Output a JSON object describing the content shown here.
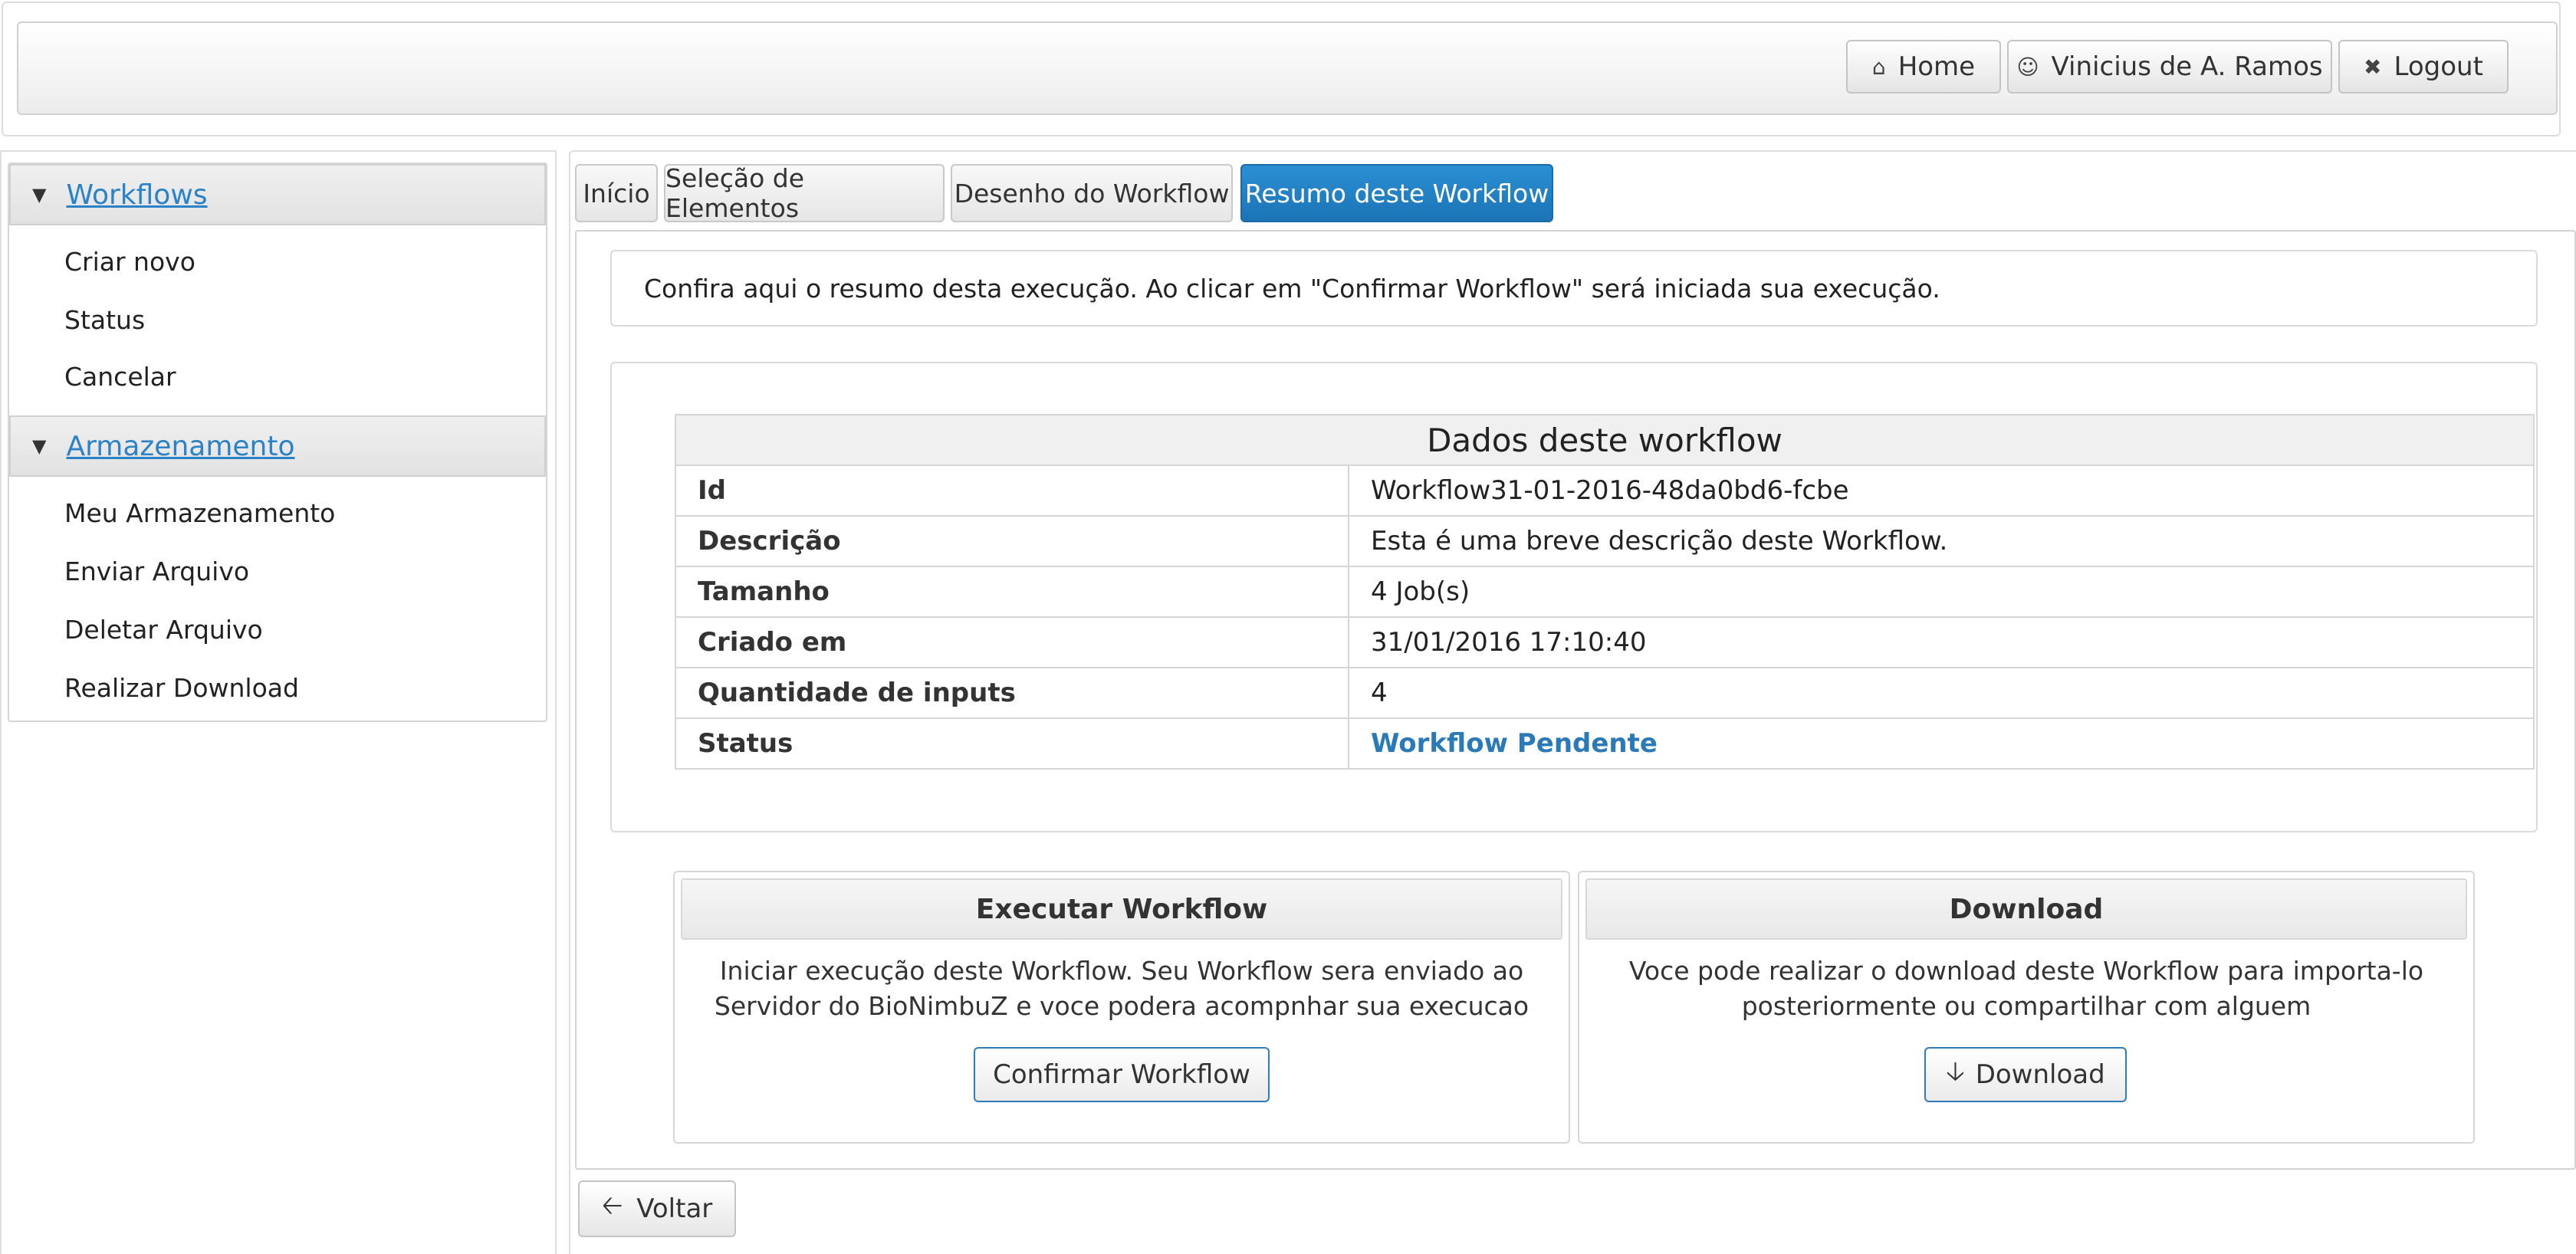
{
  "header": {
    "home_label": "Home",
    "user_label": "Vinicius de A. Ramos",
    "logout_label": "Logout"
  },
  "sidebar": {
    "sections": [
      {
        "title": "Workflows",
        "items": [
          "Criar novo",
          "Status",
          "Cancelar"
        ]
      },
      {
        "title": "Armazenamento",
        "items": [
          "Meu Armazenamento",
          "Enviar Arquivo",
          "Deletar Arquivo",
          "Realizar Download"
        ]
      }
    ]
  },
  "tabs": [
    {
      "label": "Início",
      "active": false
    },
    {
      "label": "Seleção de Elementos",
      "active": false
    },
    {
      "label": "Desenho do Workflow",
      "active": false
    },
    {
      "label": "Resumo deste Workflow",
      "active": true
    }
  ],
  "info_text": "Confira aqui o resumo desta execução. Ao clicar em \"Confirmar Workflow\" será iniciada sua execução.",
  "summary": {
    "title": "Dados deste workflow",
    "rows": [
      {
        "key": "Id",
        "value": "Workflow31-01-2016-48da0bd6-fcbe"
      },
      {
        "key": "Descrição",
        "value": "Esta é uma breve descrição deste Workflow."
      },
      {
        "key": "Tamanho",
        "value": "4 Job(s)"
      },
      {
        "key": "Criado em",
        "value": "31/01/2016 17:10:40"
      },
      {
        "key": "Quantidade de inputs",
        "value": "4"
      },
      {
        "key": "Status",
        "value": "Workflow Pendente"
      }
    ]
  },
  "execute_card": {
    "title": "Executar Workflow",
    "text_line1": "Iniciar execução deste Workflow. Seu Workflow sera enviado ao",
    "text_line2": "Servidor do BioNimbuZ e voce podera acompnhar sua execucao",
    "button_label": "Confirmar Workflow"
  },
  "download_card": {
    "title": "Download",
    "text_line1": "Voce pode realizar o download deste Workflow para importa-lo",
    "text_line2": "posteriormente ou compartilhar com alguem",
    "button_label": "Download"
  },
  "back_label": "Voltar",
  "colors": {
    "accent": "#1b74b6",
    "link": "#2a82c7"
  },
  "icons": {
    "home": "home-icon",
    "user": "user-icon",
    "logout": "close-icon",
    "download": "arrow-down-icon",
    "back": "arrow-left-icon"
  }
}
